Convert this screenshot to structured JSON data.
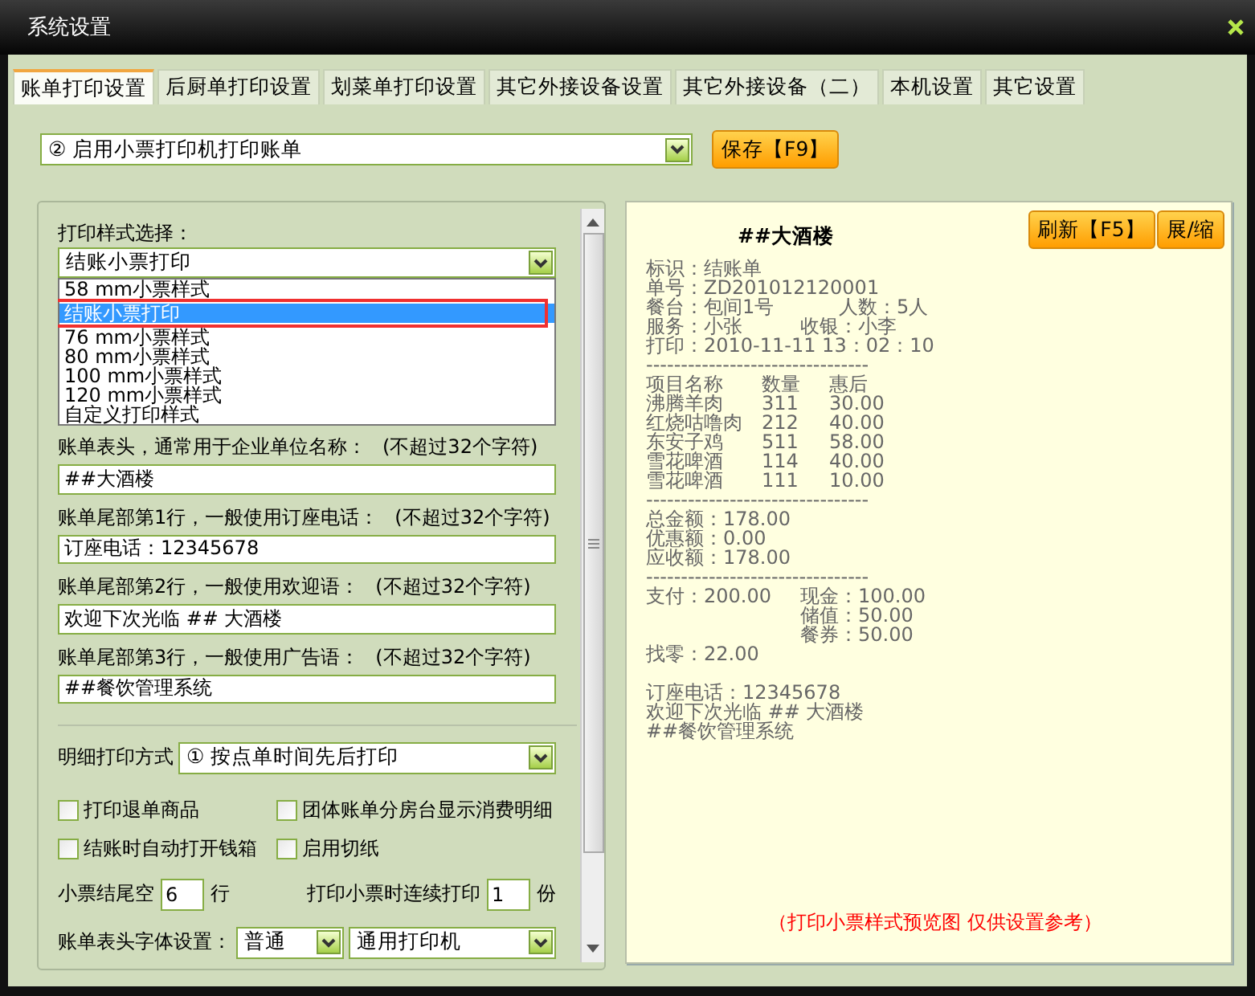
{
  "window": {
    "title": "系统设置"
  },
  "tabs": [
    {
      "label": "账单打印设置",
      "selected": true
    },
    {
      "label": "后厨单打印设置",
      "selected": false
    },
    {
      "label": "划菜单打印设置",
      "selected": false
    },
    {
      "label": "其它外接设备设置",
      "selected": false
    },
    {
      "label": "其它外接设备（二）",
      "selected": false
    },
    {
      "label": "本机设置",
      "selected": false
    },
    {
      "label": "其它设置",
      "selected": false
    }
  ],
  "print_mode": {
    "value": "② 启用小票打印机打印账单"
  },
  "save_button": "保存【F9】",
  "style_select": {
    "label": "打印样式选择：",
    "value": "结账小票打印",
    "expanded": true,
    "options": [
      {
        "label": "58  mm小票样式",
        "selected": false,
        "highlighted": false
      },
      {
        "label": "结账小票打印",
        "selected": true,
        "highlighted": true
      },
      {
        "label": "76  mm小票样式",
        "selected": false,
        "highlighted": false
      },
      {
        "label": "80  mm小票样式",
        "selected": false,
        "highlighted": false
      },
      {
        "label": "100 mm小票样式",
        "selected": false,
        "highlighted": false
      },
      {
        "label": "120 mm小票样式",
        "selected": false,
        "highlighted": false
      },
      {
        "label": "自定义打印样式",
        "selected": false,
        "highlighted": false
      }
    ]
  },
  "text_fields": [
    {
      "label": "账单表头，通常用于企业单位名称：",
      "limit": "(不超过32个字符)",
      "value": "##大酒楼"
    },
    {
      "label": "账单尾部第1行，一般使用订座电话：",
      "limit": "(不超过32个字符)",
      "value": "订座电话：12345678"
    },
    {
      "label": "账单尾部第2行，一般使用欢迎语：",
      "limit": "(不超过32个字符)",
      "value": "欢迎下次光临 ## 大酒楼"
    },
    {
      "label": "账单尾部第3行，一般使用广告语：",
      "limit": "(不超过32个字符)",
      "value": "##餐饮管理系统"
    }
  ],
  "detail_mode": {
    "label": "明细打印方式",
    "value": "① 按点单时间先后打印"
  },
  "checkboxes": [
    {
      "label": "打印退单商品",
      "checked": false
    },
    {
      "label": "团体账单分房台显示消费明细",
      "checked": false
    },
    {
      "label": "结账时自动打开钱箱",
      "checked": false
    },
    {
      "label": "启用切纸",
      "checked": false
    }
  ],
  "tail_blank": {
    "label": "小票结尾空",
    "value": "6",
    "unit": "行"
  },
  "copies": {
    "label": "打印小票时连续打印",
    "value": "1",
    "unit": "份"
  },
  "header_font": {
    "label": "账单表头字体设置：",
    "font": "普通",
    "printer": "通用打印机"
  },
  "preview": {
    "title": "##大酒楼",
    "refresh_button": "刷新【F5】",
    "toggle_button": "展/缩",
    "lines": [
      {
        "kind": "single",
        "cells": [
          "标识：结账单"
        ]
      },
      {
        "kind": "single",
        "cells": [
          "单号：ZD201012120001"
        ]
      },
      {
        "kind": "wide",
        "cells": [
          "餐台：包间1号",
          "人数：5人"
        ]
      },
      {
        "kind": "pair",
        "cells": [
          "服务：小张",
          "收银：小李"
        ]
      },
      {
        "kind": "single",
        "cells": [
          "打印：2010-11-11 13：02：10"
        ]
      },
      {
        "kind": "single",
        "cells": [
          "--------------------------------"
        ]
      },
      {
        "kind": "item",
        "cells": [
          "项目名称",
          "数量",
          "惠后"
        ]
      },
      {
        "kind": "item",
        "cells": [
          "沸腾羊肉",
          "311",
          "30.00"
        ]
      },
      {
        "kind": "item",
        "cells": [
          "红烧咕噜肉",
          "212",
          "40.00"
        ]
      },
      {
        "kind": "item",
        "cells": [
          "东安子鸡",
          "511",
          "58.00"
        ]
      },
      {
        "kind": "item",
        "cells": [
          "雪花啤酒",
          "114",
          "40.00"
        ]
      },
      {
        "kind": "item",
        "cells": [
          "雪花啤酒",
          "111",
          "10.00"
        ]
      },
      {
        "kind": "single",
        "cells": [
          "--------------------------------"
        ]
      },
      {
        "kind": "single",
        "cells": [
          "总金额：178.00"
        ]
      },
      {
        "kind": "single",
        "cells": [
          "优惠额：0.00"
        ]
      },
      {
        "kind": "single",
        "cells": [
          "应收额：178.00"
        ]
      },
      {
        "kind": "single",
        "cells": [
          "--------------------------------"
        ]
      },
      {
        "kind": "pair",
        "cells": [
          "支付：200.00",
          "现金：100.00"
        ]
      },
      {
        "kind": "indent",
        "cells": [
          "储值：50.00"
        ]
      },
      {
        "kind": "indent",
        "cells": [
          "餐券：50.00"
        ]
      },
      {
        "kind": "single",
        "cells": [
          "找零：22.00"
        ]
      },
      {
        "kind": "blank"
      },
      {
        "kind": "single",
        "cells": [
          "订座电话：12345678"
        ]
      },
      {
        "kind": "single",
        "cells": [
          "欢迎下次光临 ## 大酒楼"
        ]
      },
      {
        "kind": "single",
        "cells": [
          "##餐饮管理系统"
        ]
      }
    ],
    "note": "（打印小票样式预览图 仅供设置参考）"
  }
}
